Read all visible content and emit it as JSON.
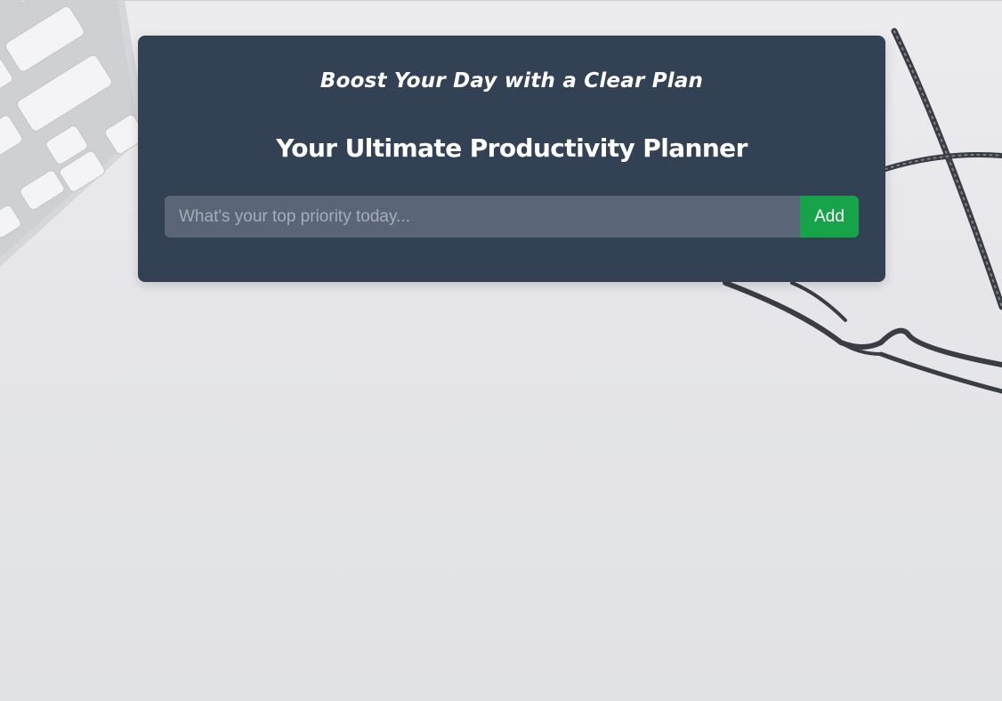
{
  "background": {
    "description_icon": "desk-photo",
    "keyboard_icon": "keyboard-icon",
    "glasses_icon": "eyeglasses-icon"
  },
  "planner": {
    "subtitle": "Boost Your Day with a Clear Plan",
    "title": "Your Ultimate Productivity Planner",
    "input": {
      "value": "",
      "placeholder": "What's your top priority today..."
    },
    "add_label": "Add"
  },
  "colors": {
    "card": "#334155",
    "input": "#5a6677",
    "accent": "#16a34a"
  }
}
